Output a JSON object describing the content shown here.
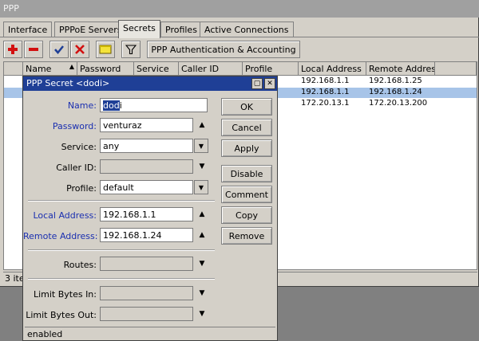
{
  "window": {
    "title": "PPP"
  },
  "tabs": [
    "Interface",
    "PPPoE Servers",
    "Secrets",
    "Profiles",
    "Active Connections"
  ],
  "active_tab": "Secrets",
  "toolbar": {
    "auth_button": "PPP Authentication & Accounting"
  },
  "table": {
    "columns": [
      "Name",
      "Password",
      "Service",
      "Caller ID",
      "Profile",
      "Local Address",
      "Remote Addres"
    ],
    "rows": [
      {
        "local": "192.168.1.1",
        "remote": "192.168.1.25"
      },
      {
        "local": "192.168.1.1",
        "remote": "192.168.1.24"
      },
      {
        "local": "172.20.13.1",
        "remote": "172.20.13.200"
      }
    ]
  },
  "status": {
    "items_text": "3 ite"
  },
  "dialog": {
    "title": "PPP Secret <dodi>",
    "labels": {
      "name": "Name:",
      "password": "Password:",
      "service": "Service:",
      "caller_id": "Caller ID:",
      "profile": "Profile:",
      "local_address": "Local Address:",
      "remote_address": "Remote Address:",
      "routes": "Routes:",
      "limit_in": "Limit Bytes In:",
      "limit_out": "Limit Bytes Out:"
    },
    "values": {
      "name_selected": "dod",
      "name_rest": "i",
      "password": "venturaz",
      "service": "any",
      "caller_id": "",
      "profile": "default",
      "local_address": "192.168.1.1",
      "remote_address": "192.168.1.24",
      "routes": "",
      "limit_in": "",
      "limit_out": ""
    },
    "buttons": {
      "ok": "OK",
      "cancel": "Cancel",
      "apply": "Apply",
      "disable": "Disable",
      "comment": "Comment",
      "copy": "Copy",
      "remove": "Remove"
    },
    "status": "enabled"
  },
  "colors": {
    "title_bar": "#1f3f96",
    "selection": "#a7c4e8",
    "label_blue": "#1a2fb0"
  },
  "icons": [
    "plus-icon",
    "minus-icon",
    "check-icon",
    "x-icon",
    "comment-icon",
    "filter-icon",
    "sort-up-icon",
    "arrow-up-icon",
    "arrow-down-icon",
    "restore-icon",
    "close-icon"
  ]
}
